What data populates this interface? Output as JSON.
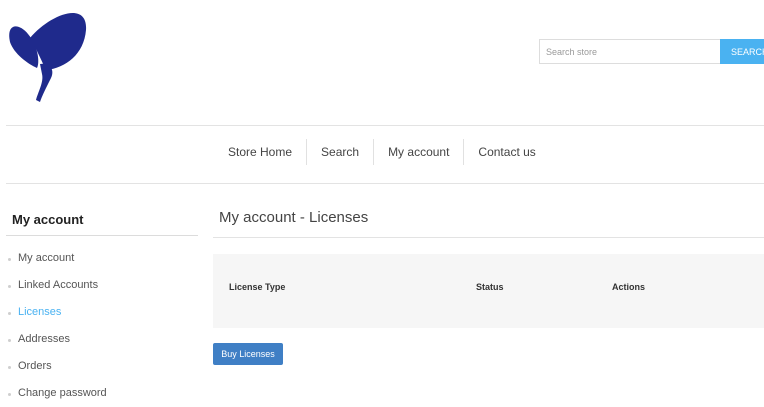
{
  "header": {
    "logo_icon": "butterfly-logo-icon",
    "brand_color": "#1f2a8c",
    "search": {
      "placeholder": "Search store",
      "button_label": "SEARCH",
      "button_color": "#4ab2f1"
    }
  },
  "nav": {
    "items": [
      {
        "label": "Store Home"
      },
      {
        "label": "Search"
      },
      {
        "label": "My account"
      },
      {
        "label": "Contact us"
      }
    ]
  },
  "sidebar": {
    "title": "My account",
    "items": [
      {
        "label": "My account",
        "active": false
      },
      {
        "label": "Linked Accounts",
        "active": false
      },
      {
        "label": "Licenses",
        "active": true
      },
      {
        "label": "Addresses",
        "active": false
      },
      {
        "label": "Orders",
        "active": false
      },
      {
        "label": "Change password",
        "active": false
      }
    ],
    "active_color": "#4ab2f1"
  },
  "main": {
    "title": "My account - Licenses",
    "table": {
      "columns": [
        "License Type",
        "Status",
        "Actions"
      ]
    },
    "buy_button_label": "Buy Licenses",
    "buy_button_color": "#3f7fc5"
  }
}
